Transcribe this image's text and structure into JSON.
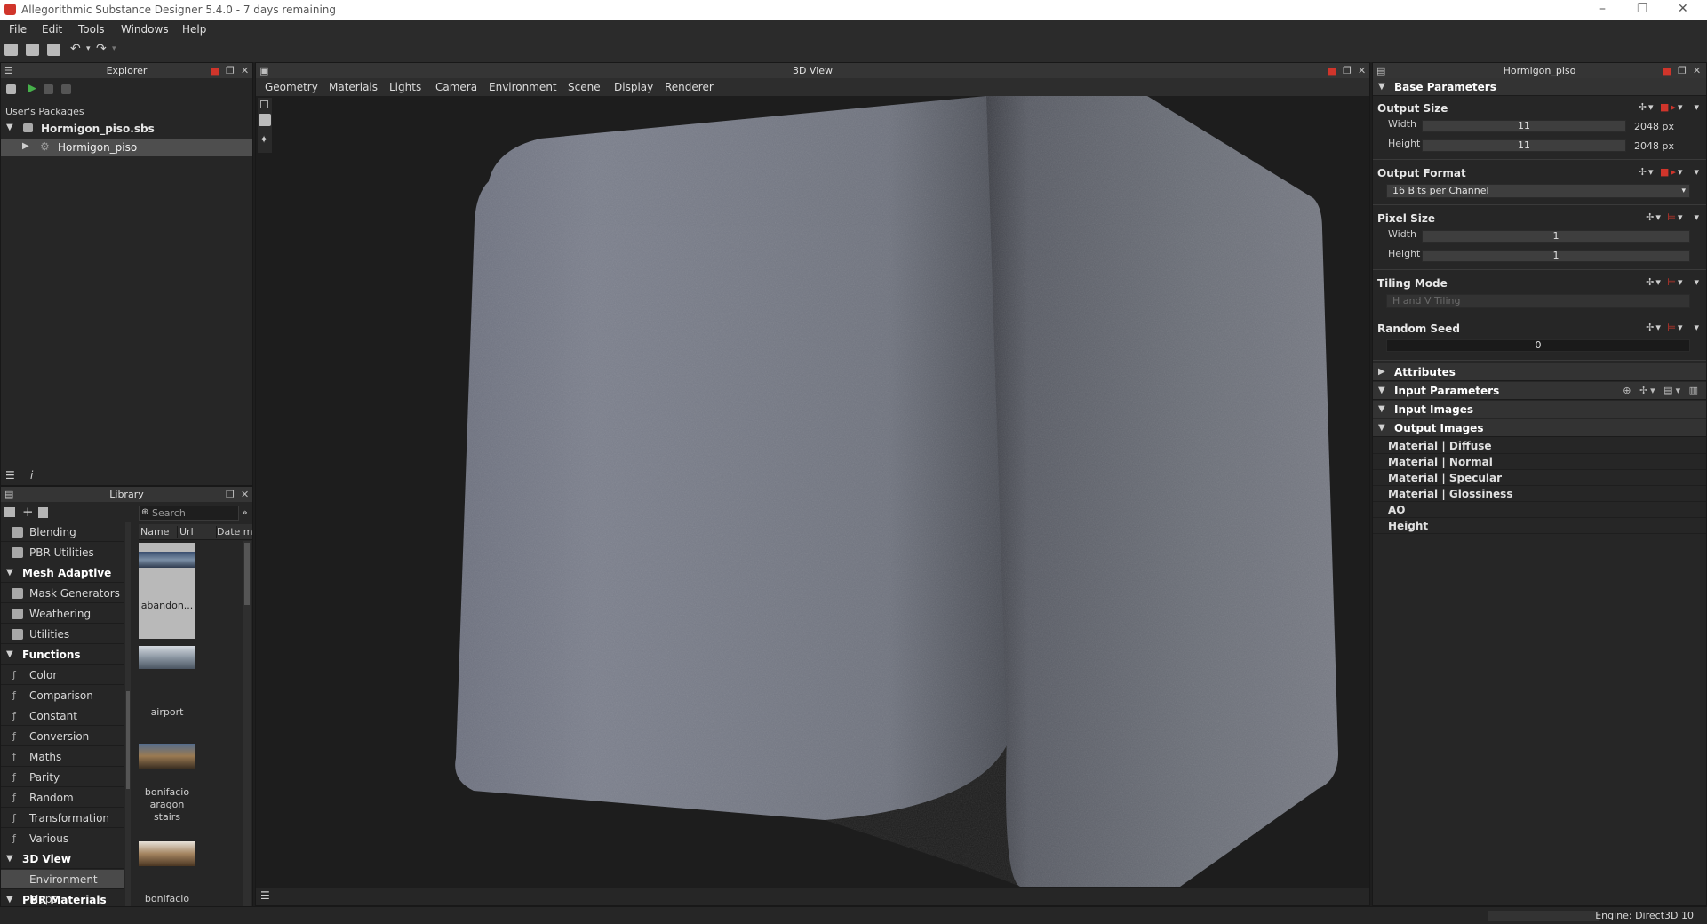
{
  "window": {
    "title": "Allegorithmic Substance Designer 5.4.0 - 7 days remaining"
  },
  "menu": [
    "File",
    "Edit",
    "Tools",
    "Windows",
    "Help"
  ],
  "explorer": {
    "header": "Explorer",
    "users_packages": "User's Packages",
    "package_name": "Hormigon_piso.sbs",
    "graph_name": "Hormigon_piso",
    "footer_info": "i"
  },
  "library": {
    "header": "Library",
    "search_placeholder": "Search",
    "columns": [
      "Name",
      "Url",
      "Date m"
    ],
    "items": [
      {
        "label": "Blending",
        "kind": "pkg"
      },
      {
        "label": "PBR Utilities",
        "kind": "pkg"
      },
      {
        "label": "Mesh Adaptive",
        "kind": "section"
      },
      {
        "label": "Mask Generators",
        "kind": "pkg"
      },
      {
        "label": "Weathering",
        "kind": "pkg"
      },
      {
        "label": "Utilities",
        "kind": "pkg"
      },
      {
        "label": "Functions",
        "kind": "section"
      },
      {
        "label": "Color",
        "kind": "fn"
      },
      {
        "label": "Comparison",
        "kind": "fn"
      },
      {
        "label": "Constant",
        "kind": "fn"
      },
      {
        "label": "Conversion",
        "kind": "fn"
      },
      {
        "label": "Maths",
        "kind": "fn"
      },
      {
        "label": "Parity",
        "kind": "fn"
      },
      {
        "label": "Random",
        "kind": "fn"
      },
      {
        "label": "Transformation",
        "kind": "fn"
      },
      {
        "label": "Various",
        "kind": "fn"
      },
      {
        "label": "3D View",
        "kind": "section"
      },
      {
        "label": "Environment Maps",
        "kind": "selected"
      },
      {
        "label": "PBR Materials",
        "kind": "section"
      }
    ],
    "thumbnails": [
      {
        "label": "abandon..."
      },
      {
        "label": "airport"
      },
      {
        "label": "bonifacio aragon stairs"
      },
      {
        "label": "bonifacio"
      }
    ]
  },
  "view3d": {
    "header": "3D View",
    "tabs": [
      "Geometry",
      "Materials",
      "Lights",
      "Camera",
      "Environment",
      "Scene",
      "Display",
      "Renderer"
    ]
  },
  "params": {
    "header": "Hormigon_piso",
    "base_parameters": "Base Parameters",
    "output_size": {
      "label": "Output Size",
      "width_label": "Width",
      "width_value": "11",
      "width_unit": "2048 px",
      "height_label": "Height",
      "height_value": "11",
      "height_unit": "2048 px"
    },
    "output_format": {
      "label": "Output Format",
      "value": "16 Bits per Channel"
    },
    "pixel_size": {
      "label": "Pixel Size",
      "width_label": "Width",
      "width_value": "1",
      "height_label": "Height",
      "height_value": "1"
    },
    "tiling_mode": {
      "label": "Tiling Mode",
      "value": "H and V Tiling"
    },
    "random_seed": {
      "label": "Random Seed",
      "value": "0"
    },
    "attributes": "Attributes",
    "input_parameters": "Input Parameters",
    "input_images": "Input Images",
    "output_images": "Output Images",
    "outputs": [
      "Material | Diffuse",
      "Material | Normal",
      "Material | Specular",
      "Material | Glossiness",
      "AO",
      "Height"
    ]
  },
  "status": {
    "engine": "Engine: Direct3D 10"
  },
  "colors": {
    "accent_red": "#d0352b",
    "panel_bg": "#262626",
    "material_gray": "#7d808a"
  }
}
